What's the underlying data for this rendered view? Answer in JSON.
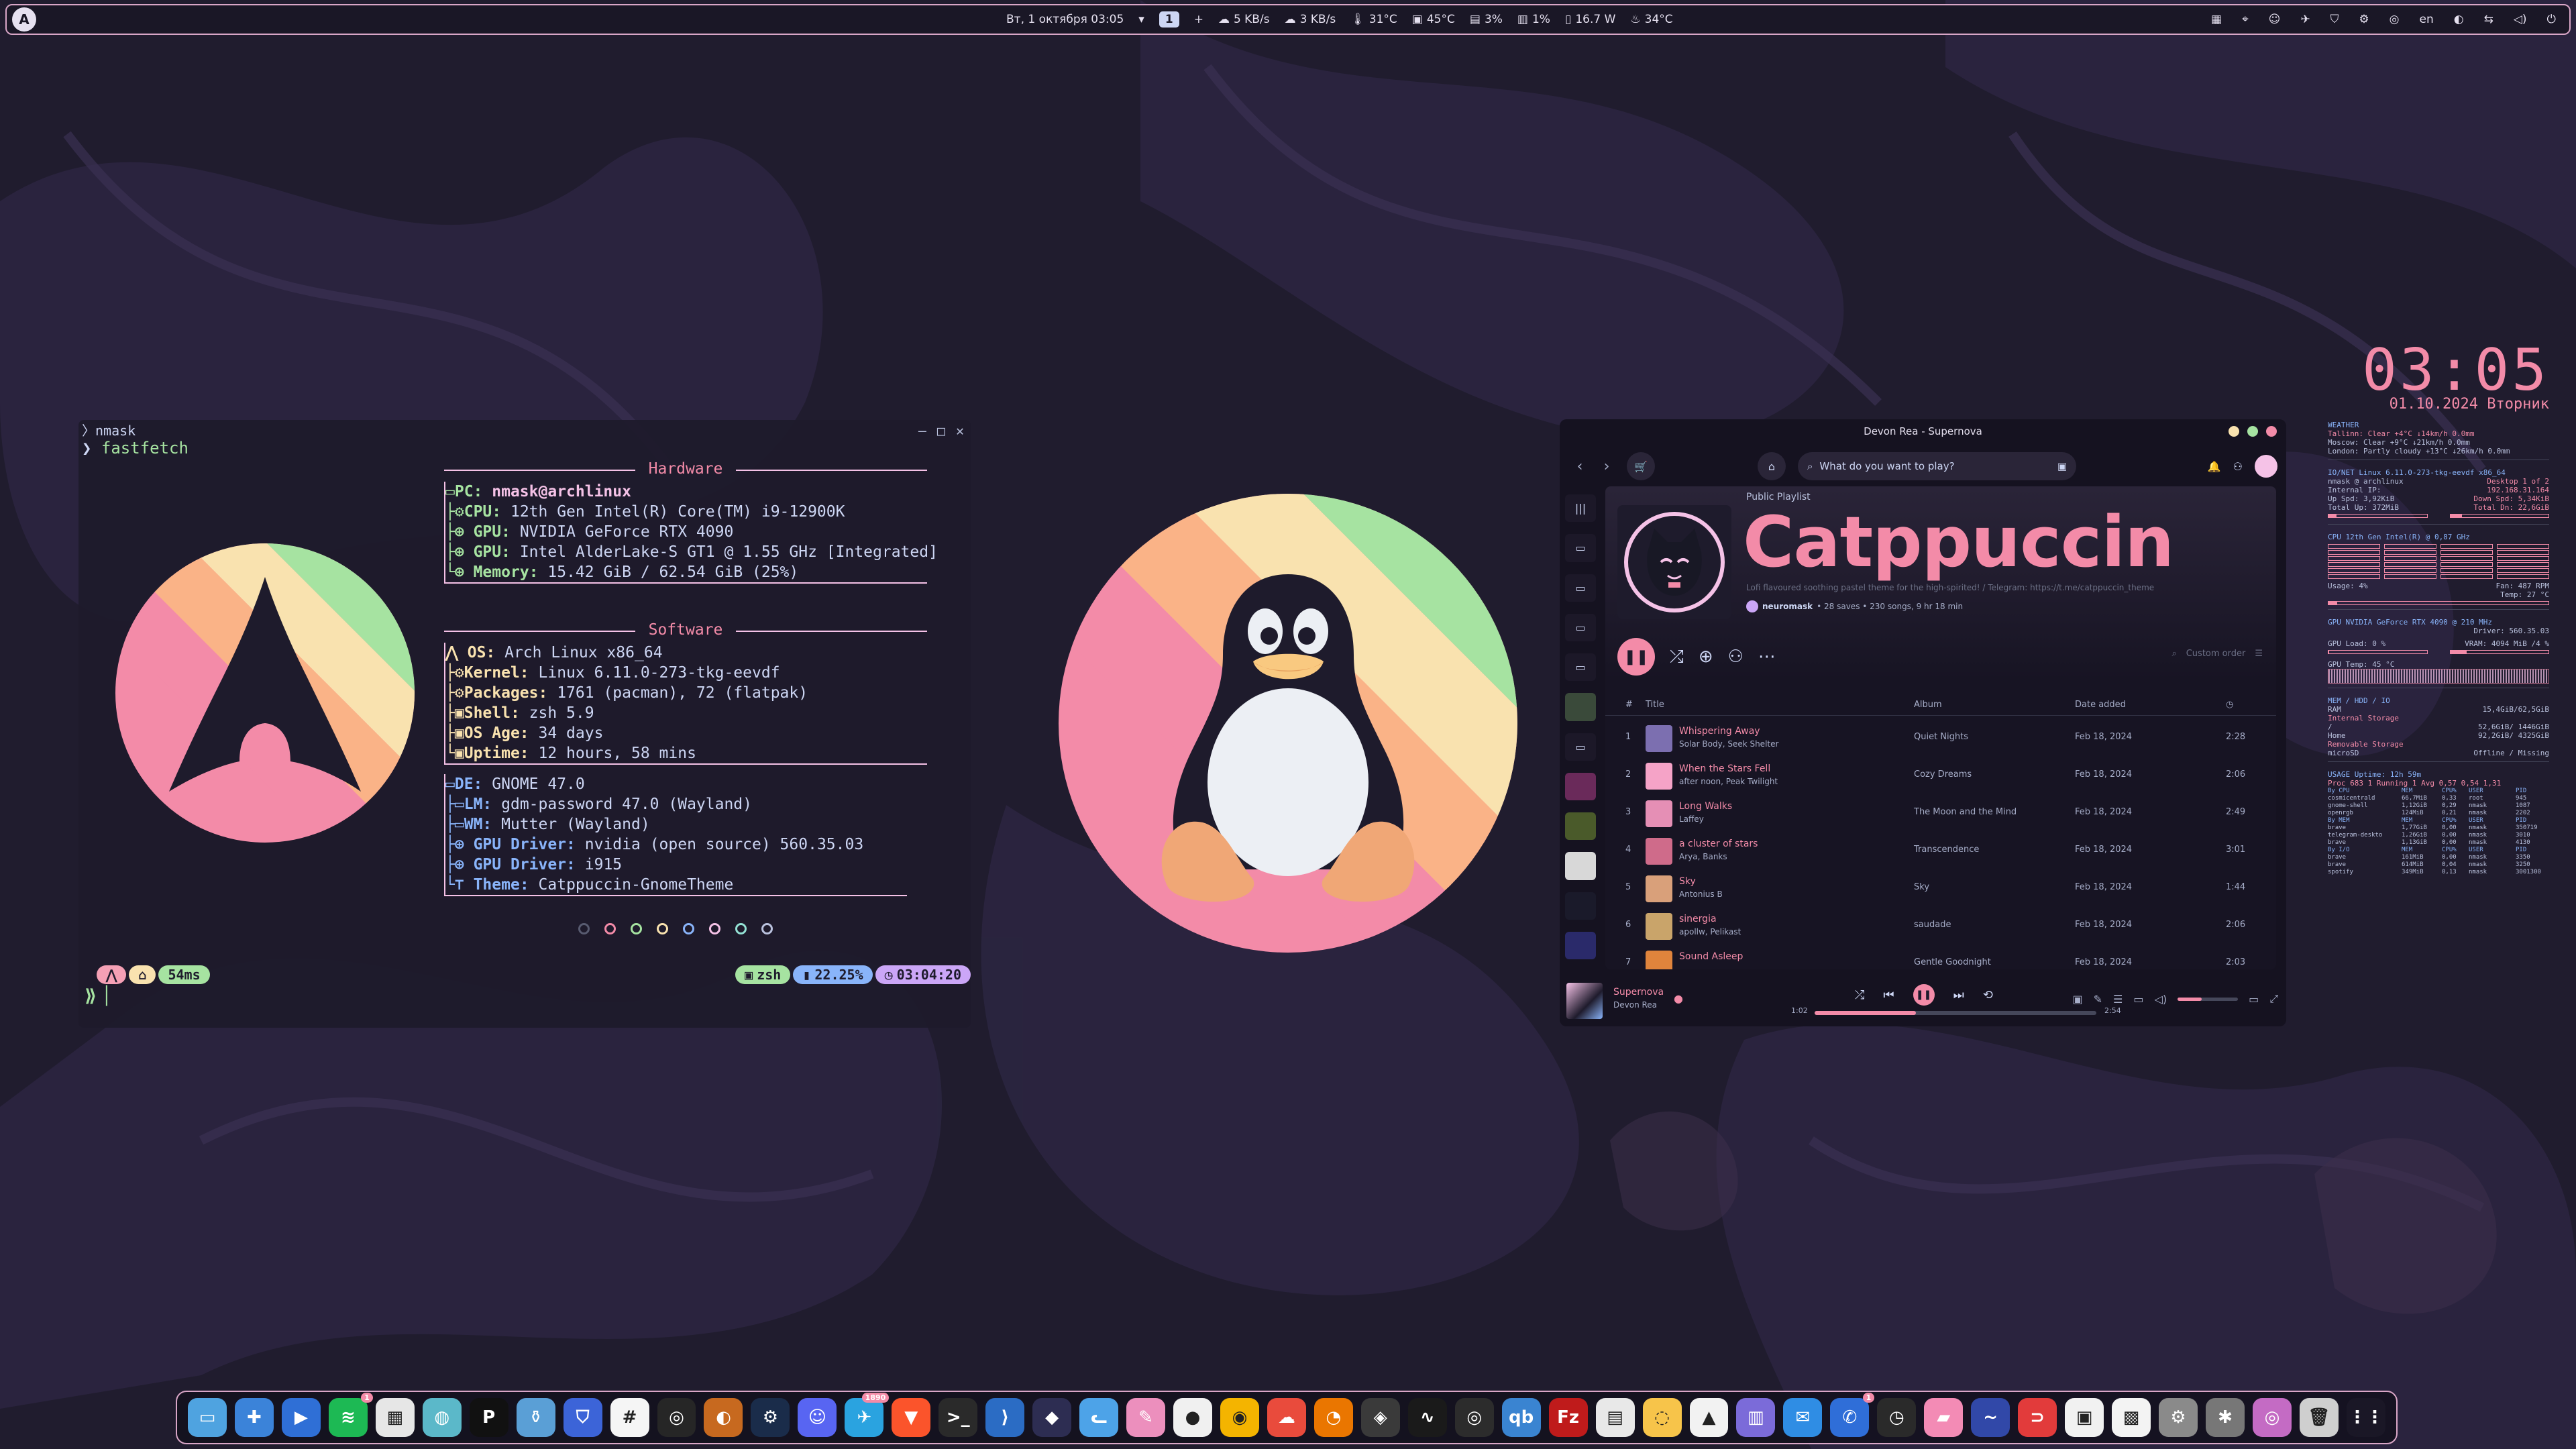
{
  "topbar": {
    "date_time": "Вт, 1 октября  03:05",
    "workspace": "1",
    "net_down": "5 KB/s",
    "net_up": "3 KB/s",
    "cpu_temp": "31°C",
    "gpu_temp": "45°C",
    "cpu_load": "3%",
    "gpu_load": "1%",
    "power": "16.7 W",
    "weather_temp": "34°C",
    "lang": "en"
  },
  "terminal": {
    "user": "nmask",
    "command": "fastfetch",
    "hardware_header": "Hardware",
    "software_header": "Software",
    "hardware": [
      {
        "key": "PC:",
        "value": "nmask@archlinux"
      },
      {
        "key": "CPU:",
        "value": "12th Gen Intel(R) Core(TM) i9-12900K"
      },
      {
        "key": "GPU:",
        "value": "NVIDIA GeForce RTX 4090"
      },
      {
        "key": "GPU:",
        "value": "Intel AlderLake-S GT1 @ 1.55 GHz [Integrated]"
      },
      {
        "key": "Memory:",
        "value": "15.42 GiB / 62.54 GiB (25%)"
      }
    ],
    "software_os": [
      {
        "key": "OS:",
        "value": "Arch Linux x86_64"
      },
      {
        "key": "Kernel:",
        "value": "Linux 6.11.0-273-tkg-eevdf"
      },
      {
        "key": "Packages:",
        "value": "1761 (pacman), 72 (flatpak)"
      },
      {
        "key": "Shell:",
        "value": "zsh 5.9"
      },
      {
        "key": "OS Age:",
        "value": "34 days"
      },
      {
        "key": "Uptime:",
        "value": "12 hours, 58 mins"
      }
    ],
    "software_de": [
      {
        "key": "DE:",
        "value": "GNOME 47.0"
      },
      {
        "key": "LM:",
        "value": "gdm-password 47.0 (Wayland)"
      },
      {
        "key": "WM:",
        "value": "Mutter (Wayland)"
      },
      {
        "key": "GPU Driver:",
        "value": "nvidia (open source) 560.35.03"
      },
      {
        "key": "GPU Driver:",
        "value": "i915"
      },
      {
        "key": "Theme:",
        "value": "Catppuccin-GnomeTheme"
      }
    ],
    "prompt_time_ms": "54ms",
    "shell": "zsh",
    "battery": "22.25%",
    "clock": "03:04:20"
  },
  "spotify": {
    "window_title": "Devon Rea - Supernova",
    "search_placeholder": "What do you want to play?",
    "playlist_type": "Public Playlist",
    "playlist_name": "Catppuccin",
    "playlist_desc": "Lofi flavoured soothing pastel theme for the high-spirited! / Telegram: https://t.me/catppuccin_theme",
    "owner": "neuromask",
    "stats": "• 28 saves • 230 songs, 9 hr 18 min",
    "sort_label": "Custom order",
    "headers": {
      "num": "#",
      "title": "Title",
      "album": "Album",
      "date": "Date added"
    },
    "tracks": [
      {
        "n": "1",
        "title": "Whispering Away",
        "artist": "Solar Body, Seek Shelter",
        "album": "Quiet Nights",
        "date": "Feb 18, 2024",
        "dur": "2:28",
        "color": "#7c6fb0"
      },
      {
        "n": "2",
        "title": "When the Stars Fell",
        "artist": "after noon, Peak Twilight",
        "album": "Cozy Dreams",
        "date": "Feb 18, 2024",
        "dur": "2:06",
        "color": "#f5a3c7"
      },
      {
        "n": "3",
        "title": "Long Walks",
        "artist": "Laffey",
        "album": "The Moon and the Mind",
        "date": "Feb 18, 2024",
        "dur": "2:49",
        "color": "#e58fb5"
      },
      {
        "n": "4",
        "title": "a cluster of stars",
        "artist": "Arya, Banks",
        "album": "Transcendence",
        "date": "Feb 18, 2024",
        "dur": "3:01",
        "color": "#cf6b8a"
      },
      {
        "n": "5",
        "title": "Sky",
        "artist": "Antonius B",
        "album": "Sky",
        "date": "Feb 18, 2024",
        "dur": "1:44",
        "color": "#d9a07a"
      },
      {
        "n": "6",
        "title": "sinergia",
        "artist": "apollw, Pelikast",
        "album": "saudade",
        "date": "Feb 18, 2024",
        "dur": "2:06",
        "color": "#c9a46a"
      },
      {
        "n": "7",
        "title": "Sound Asleep",
        "artist": "",
        "album": "Gentle Goodnight",
        "date": "Feb 18, 2024",
        "dur": "2:03",
        "color": "#e0843c"
      }
    ],
    "now_playing": {
      "title": "Supernova",
      "artist": "Devon Rea",
      "elapsed": "1:02",
      "total": "2:54",
      "progress": 0.36
    }
  },
  "conky": {
    "time": "03:05",
    "date": "01.10.2024 Вторник",
    "weather_h": "WEATHER",
    "weather": [
      "Tallinn: Clear +4°C ↓14km/h 0.0mm",
      "Moscow: Clear +9°C ↓21km/h 0.0mm",
      "London: Partly cloudy +13°C ↓26km/h 0.0mm"
    ],
    "net_h": "IO/NET Linux 6.11.0-273-tkg-eevdf x86_64",
    "net": [
      [
        "nmask @ archlinux",
        "Desktop 1 of 2"
      ],
      [
        "Internal IP:",
        "192.168.31.164"
      ],
      [
        "Up Spd: 3,92KiB",
        "Down Spd: 5,34KiB"
      ],
      [
        "Total Up: 372MiB",
        "Total Dn: 22,6GiB"
      ]
    ],
    "cpu_h": "CPU        12th Gen Intel(R) @ 0,87 GHz",
    "cpu_usage": "Usage: 4%",
    "cpu_fan": "Fan: 487 RPM",
    "cpu_temp": "Temp: 27 °C",
    "gpu_h": "GPU     NVIDIA GeForce RTX 4090 @ 210 MHz",
    "gpu_driver": "Driver: 560.35.03",
    "gpu_load": "GPU Load: 0 %",
    "gpu_vram": "VRAM: 4094 MiB /4 %",
    "gpu_temp": "GPU Temp: 45 °C",
    "mem_h": "MEM / HDD / IO",
    "mem": [
      [
        "RAM",
        "15,4GiB/62,5GiB"
      ],
      [
        "Internal Storage",
        ""
      ],
      [
        "/",
        "52,6GiB/ 1446GiB"
      ],
      [
        "Home",
        "92,2GiB/ 4325GiB"
      ],
      [
        "Removable Storage",
        ""
      ],
      [
        "microSD",
        "Offline / Missing"
      ]
    ],
    "usage_h": "USAGE        Uptime: 12h 59m",
    "usage_sub": "Proc 683   1 Running   1 Avg 0,57 0,54 1,31",
    "procs": [
      [
        "By CPU",
        "MEM",
        "CPU%",
        "USER",
        "PID"
      ],
      [
        "cosmicentrald",
        "66,7MiB",
        "0,33",
        "root",
        "945"
      ],
      [
        "gnome-shell",
        "1,12GiB",
        "0,29",
        "nmask",
        "1087"
      ],
      [
        "openrgb",
        "124MiB",
        "0,21",
        "nmask",
        "2202"
      ],
      [
        "By MEM",
        "MEM",
        "CPU%",
        "USER",
        "PID"
      ],
      [
        "brave",
        "1,77GiB",
        "0,00",
        "nmask",
        "350719"
      ],
      [
        "telegram-deskto",
        "1,26GiB",
        "0,00",
        "nmask",
        "3010"
      ],
      [
        "brave",
        "1,13GiB",
        "0,00",
        "nmask",
        "4130"
      ],
      [
        "By I/O",
        "MEM",
        "CPU%",
        "USER",
        "PID"
      ],
      [
        "brave",
        "161MiB",
        "0,00",
        "nmask",
        "3350"
      ],
      [
        "brave",
        "614MiB",
        "0,04",
        "nmask",
        "3250"
      ],
      [
        "spotify",
        "349MiB",
        "0,13",
        "nmask",
        "3001300"
      ]
    ]
  },
  "dock": [
    {
      "name": "files",
      "color": "#4fa3e0",
      "glyph": "▭"
    },
    {
      "name": "software",
      "color": "#3b83d9",
      "glyph": "✚"
    },
    {
      "name": "videos",
      "color": "#2f6fd6",
      "glyph": "▶"
    },
    {
      "name": "spotify",
      "color": "#1db954",
      "glyph": "≋",
      "badge": "1"
    },
    {
      "name": "toolbox",
      "color": "#e6e6e6",
      "glyph": "▦"
    },
    {
      "name": "globe",
      "color": "#5bb8c9",
      "glyph": "◍"
    },
    {
      "name": "proton-pass",
      "color": "#111111",
      "glyph": "P"
    },
    {
      "name": "archive",
      "color": "#5a9fd6",
      "glyph": "⚱"
    },
    {
      "name": "bitwarden",
      "color": "#3c64d8",
      "glyph": "⛉"
    },
    {
      "name": "tables",
      "color": "#f5f5f5",
      "glyph": "#"
    },
    {
      "name": "gpu",
      "color": "#262626",
      "glyph": "◎"
    },
    {
      "name": "blender-alt",
      "color": "#c7691f",
      "glyph": "◐"
    },
    {
      "name": "steam",
      "color": "#1a2c4a",
      "glyph": "⚙"
    },
    {
      "name": "discord",
      "color": "#5865f2",
      "glyph": "☺"
    },
    {
      "name": "telegram",
      "color": "#2aa3e0",
      "glyph": "✈",
      "badge": "1890"
    },
    {
      "name": "brave",
      "color": "#fb542b",
      "glyph": "▼"
    },
    {
      "name": "terminal",
      "color": "#2a2a2a",
      "glyph": ">_"
    },
    {
      "name": "vscode",
      "color": "#2b6cc4",
      "glyph": "⟩"
    },
    {
      "name": "ethereum",
      "color": "#2d2d52",
      "glyph": "◆"
    },
    {
      "name": "cat-app",
      "color": "#4da3e8",
      "glyph": "ᓚ"
    },
    {
      "name": "paint",
      "color": "#ec8fbd",
      "glyph": "✎"
    },
    {
      "name": "github",
      "color": "#f0f0f0",
      "glyph": "●"
    },
    {
      "name": "chrome",
      "color": "#f4b400",
      "glyph": "◉"
    },
    {
      "name": "cloud",
      "color": "#e94b3c",
      "glyph": "☁"
    },
    {
      "name": "blender",
      "color": "#ea7600",
      "glyph": "◔"
    },
    {
      "name": "resolve",
      "color": "#3a3a3a",
      "glyph": "◈"
    },
    {
      "name": "inkscape",
      "color": "#1a1a1a",
      "glyph": "∿"
    },
    {
      "name": "obs",
      "color": "#2c2c2c",
      "glyph": "◎"
    },
    {
      "name": "qbittorrent",
      "color": "#3a84d1",
      "glyph": "qb"
    },
    {
      "name": "filezilla",
      "color": "#bf1b1b",
      "glyph": "Fz"
    },
    {
      "name": "notes",
      "color": "#e8e8e8",
      "glyph": "▤"
    },
    {
      "name": "gnome-software",
      "color": "#f7c44a",
      "glyph": "◌"
    },
    {
      "name": "tux-cat",
      "color": "#f2f2f2",
      "glyph": "▲"
    },
    {
      "name": "timeline",
      "color": "#7b6bd9",
      "glyph": "▥"
    },
    {
      "name": "mail",
      "color": "#2f8de4",
      "glyph": "✉"
    },
    {
      "name": "messenger",
      "color": "#2f6ed8",
      "glyph": "✆",
      "badge": "1"
    },
    {
      "name": "clock",
      "color": "#2a2a2a",
      "glyph": "◷"
    },
    {
      "name": "pink-app",
      "color": "#f38bb5",
      "glyph": "▰"
    },
    {
      "name": "waves",
      "color": "#3148a8",
      "glyph": "∼"
    },
    {
      "name": "red-app",
      "color": "#e23b3b",
      "glyph": "⊃"
    },
    {
      "name": "window-app",
      "color": "#f1f1f1",
      "glyph": "▣"
    },
    {
      "name": "dashboard",
      "color": "#f3f3f3",
      "glyph": "▩"
    },
    {
      "name": "settings",
      "color": "#8a8a8a",
      "glyph": "⚙"
    },
    {
      "name": "tweaks",
      "color": "#777777",
      "glyph": "✱"
    },
    {
      "name": "photo",
      "color": "#c46bc4",
      "glyph": "◎"
    },
    {
      "name": "trash",
      "color": "#cfcfcf",
      "glyph": "🗑"
    },
    {
      "name": "app-grid",
      "color": "#1a1726",
      "glyph": "⋮⋮"
    }
  ],
  "colors": {
    "accent": "#f38ba8",
    "border": "#d9a6c7",
    "rainbow": [
      "#f38ba8",
      "#fab387",
      "#f9e2af",
      "#a6e3a1",
      "#89dceb",
      "#89b4fa",
      "#cba6f7"
    ]
  }
}
